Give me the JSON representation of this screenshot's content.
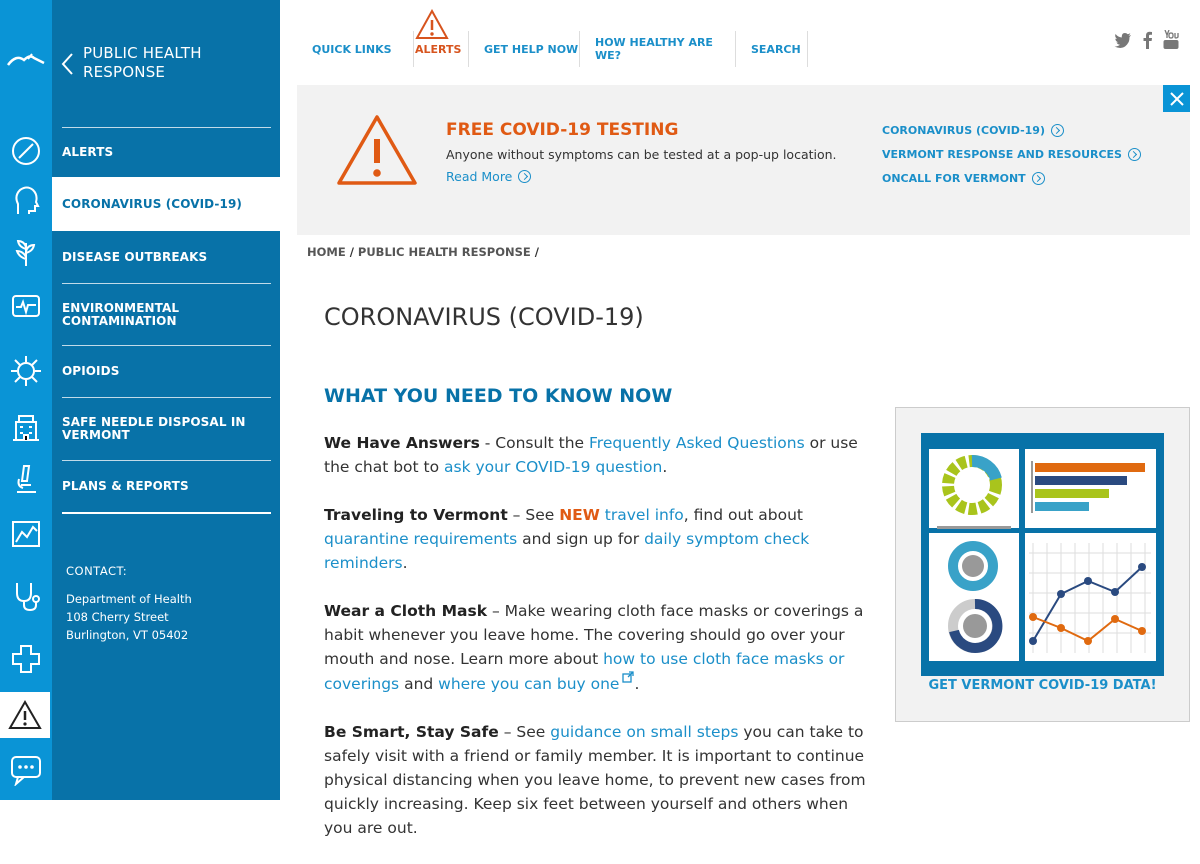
{
  "sidebar": {
    "title": "PUBLIC HEALTH RESPONSE",
    "items": [
      {
        "label": "ALERTS"
      },
      {
        "label": "CORONAVIRUS (COVID-19)"
      },
      {
        "label": "DISEASE OUTBREAKS"
      },
      {
        "label": "ENVIRONMENTAL CONTAMINATION"
      },
      {
        "label": "OPIOIDS"
      },
      {
        "label": "SAFE NEEDLE DISPOSAL IN VERMONT"
      },
      {
        "label": "PLANS & REPORTS"
      }
    ],
    "contact": {
      "heading": "CONTACT:",
      "org": "Department of Health",
      "street": "108 Cherry Street",
      "city": "Burlington, VT 05402"
    }
  },
  "rail_icons": [
    "health-logo-icon",
    "pill-icon",
    "head-icon",
    "plant-icon",
    "monitor-pulse-icon",
    "virus-icon",
    "building-icon",
    "microscope-icon",
    "chart-icon",
    "stethoscope-icon",
    "plus-icon"
  ],
  "topnav": {
    "quick_links": "QUICK LINKS",
    "alerts": "ALERTS",
    "get_help": "GET HELP NOW",
    "how_healthy": "HOW HEALTHY ARE WE?",
    "search": "SEARCH"
  },
  "banner": {
    "title": "FREE COVID-19 TESTING",
    "desc": "Anyone without symptoms can be tested at a pop-up location.",
    "more": "Read More",
    "links": [
      "CORONAVIRUS (COVID-19)",
      "VERMONT RESPONSE AND RESOURCES",
      "ONCALL FOR VERMONT"
    ]
  },
  "breadcrumb": {
    "home": "HOME",
    "section": "PUBLIC HEALTH RESPONSE",
    "sep": "/"
  },
  "page": {
    "title": "CORONAVIRUS (COVID-19)"
  },
  "content": {
    "heading": "WHAT YOU NEED TO KNOW NOW",
    "p1": {
      "bold": "We Have Answers",
      "t1": " - Consult the ",
      "l1": "Frequently Asked Questions",
      "t2": " or use the chat bot to ",
      "l2": "ask your COVID-19 question",
      "t3": "."
    },
    "p2": {
      "bold": "Traveling to Vermont",
      "t1": " – See ",
      "new": "NEW",
      "l1": " travel info",
      "t2": ", find out about ",
      "l2": "quarantine requirements",
      "t3": " and sign up for ",
      "l3": "daily symptom check reminders",
      "t4": "."
    },
    "p3": {
      "bold": "Wear a Cloth Mask",
      "t1": " – Make wearing cloth face masks or coverings a habit whenever you leave home. The covering should go over your mouth and nose. Learn more about ",
      "l1": "how to use cloth face masks or coverings",
      "t2": " and ",
      "l2": "where you can buy one",
      "t3": "."
    },
    "p4": {
      "bold": "Be Smart, Stay Safe",
      "t1": " – See ",
      "l1": "guidance on small steps",
      "t2": " you can take to safely visit with a friend or family member. It is important to continue physical distancing when you leave home, to prevent new cases from quickly increasing. Keep six feet between yourself and others when you are out."
    }
  },
  "datacard": {
    "label": "GET VERMONT COVID-19 DATA!"
  },
  "colors": {
    "rail": "#0a94d6",
    "sidebar": "#0872a8",
    "accent_orange": "#e05a14",
    "link": "#1b8fc9"
  },
  "social": [
    "twitter-icon",
    "facebook-icon",
    "youtube-icon"
  ]
}
